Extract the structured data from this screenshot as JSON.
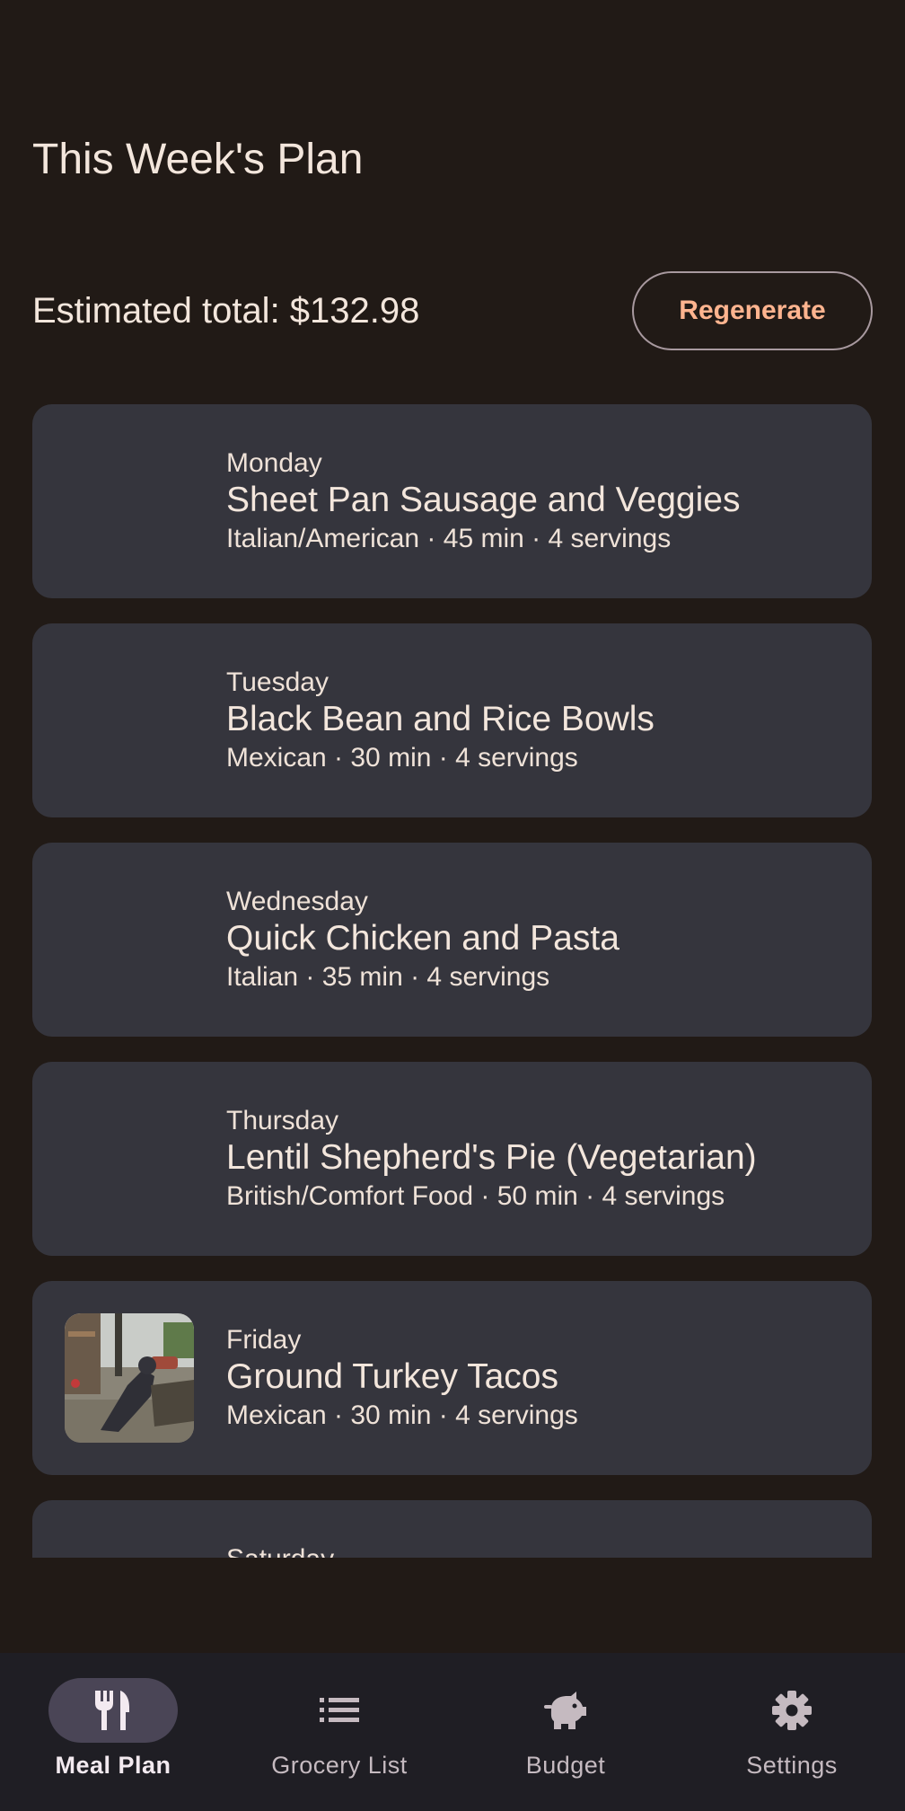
{
  "header": {
    "title": "This Week's Plan"
  },
  "summary": {
    "total_label": "Estimated total: $132.98",
    "regenerate_label": "Regenerate"
  },
  "meals": [
    {
      "day": "Monday",
      "name": "Sheet Pan Sausage and Veggies",
      "meta": "Italian/American · 45 min · 4 servings"
    },
    {
      "day": "Tuesday",
      "name": "Black Bean and Rice Bowls",
      "meta": "Mexican · 30 min · 4 servings"
    },
    {
      "day": "Wednesday",
      "name": "Quick Chicken and Pasta",
      "meta": "Italian · 35 min · 4 servings"
    },
    {
      "day": "Thursday",
      "name": "Lentil Shepherd's Pie (Vegetarian)",
      "meta": "British/Comfort Food · 50 min · 4 servings"
    },
    {
      "day": "Friday",
      "name": "Ground Turkey Tacos",
      "meta": "Mexican · 30 min · 4 servings"
    },
    {
      "day": "Saturday"
    }
  ],
  "nav": {
    "items": [
      {
        "label": "Meal Plan",
        "icon": "fork-knife-icon",
        "active": true
      },
      {
        "label": "Grocery List",
        "icon": "list-icon",
        "active": false
      },
      {
        "label": "Budget",
        "icon": "piggy-bank-icon",
        "active": false
      },
      {
        "label": "Settings",
        "icon": "gear-icon",
        "active": false
      }
    ]
  },
  "colors": {
    "background": "#211a16",
    "card": "#35353d",
    "accent": "#ffb48f",
    "nav_background": "#1f1e24",
    "nav_active_pill": "#4a4556"
  }
}
